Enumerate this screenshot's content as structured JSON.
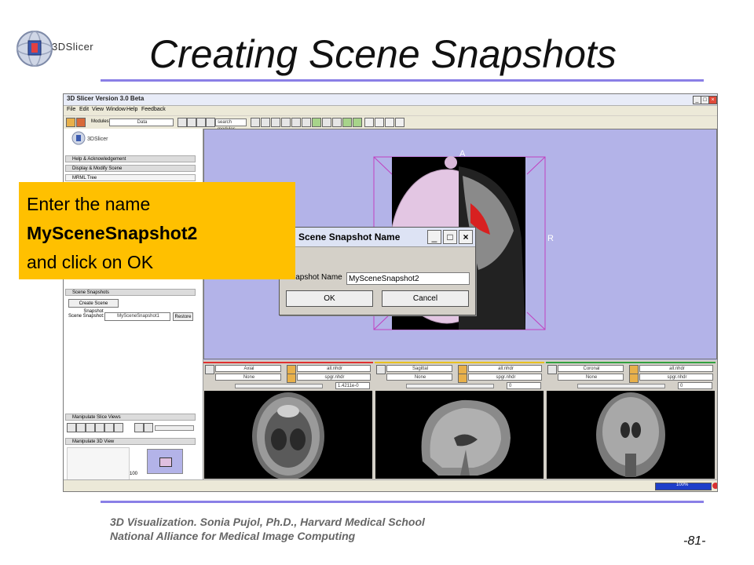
{
  "slide": {
    "logo_text": "3DSlicer",
    "title": "Creating Scene Snapshots",
    "footer_line1": "3D Visualization. Sonia Pujol, Ph.D., Harvard Medical School",
    "footer_line2": "National Alliance for Medical Image Computing",
    "page_number": "-81-"
  },
  "app": {
    "window_title": "3D Slicer Version 3.0 Beta",
    "menu": [
      "File",
      "Edit",
      "View",
      "Window",
      "Help",
      "Feedback"
    ],
    "toolbar": {
      "modules_label": "Modules:",
      "module_value": "Data",
      "search_placeholder": "search modules"
    },
    "left_panel": {
      "logo_text": "3DSlicer",
      "sections": {
        "help": "Help & Acknowledgement",
        "display": "Display & Modify Scene",
        "mrml_tree": "MRML Tree",
        "scene_snapshots": "Scene Snapshots",
        "manipulate_slice_views": "Manipulate Slice Views",
        "manipulate_3d_view": "Manipulate 3D View"
      },
      "create_snapshot_button": "Create Scene Snapshot",
      "scene_snapshot_label": "Scene Snapshot:",
      "scene_snapshot_value": "MySceneSnapshot1",
      "restore_button": "Restore",
      "zoom_value": "100"
    },
    "view3d": {
      "label_a": "A",
      "label_r": "R"
    },
    "slices": [
      {
        "orientation": "Axial",
        "fg": "all.nhdr",
        "bg": "None",
        "label": "spgr.nhdr",
        "offset": "1.4211e-0",
        "color": "#e03030"
      },
      {
        "orientation": "Sagittal",
        "fg": "all.nhdr",
        "bg": "None",
        "label": "spgr.nhdr",
        "offset": "0",
        "color": "#e8c020"
      },
      {
        "orientation": "Coronal",
        "fg": "all.nhdr",
        "bg": "None",
        "label": "spgr.nhdr",
        "offset": "0",
        "color": "#30a040"
      }
    ],
    "status": {
      "progress": "100%"
    }
  },
  "dialog": {
    "title": "Scene Snapshot Name",
    "label": "Snapshot Name",
    "value": "MySceneSnapshot2",
    "ok": "OK",
    "cancel": "Cancel"
  },
  "callout": {
    "line1": "Enter the name",
    "line2": "MySceneSnapshot2",
    "line3": "and click on OK"
  },
  "colors": {
    "accent_rule": "#8a7fe6",
    "callout_bg": "#ffc000",
    "view3d_bg": "#b3b3e8"
  }
}
